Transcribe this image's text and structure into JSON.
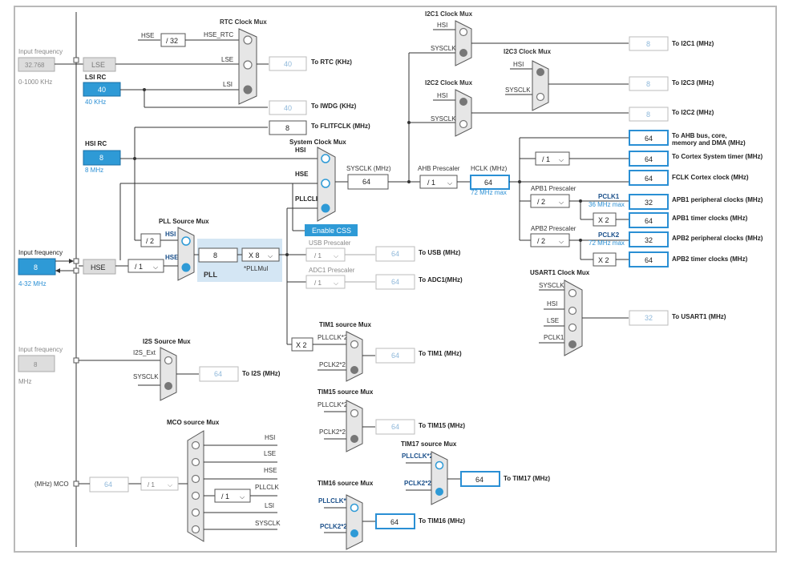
{
  "rtc_mux": {
    "title": "RTC Clock Mux",
    "in_hse": "HSE",
    "div32": "/ 32",
    "in_hse_rtc": "HSE_RTC",
    "in_lse": "LSE",
    "in_lsi": "LSI",
    "out_value": "40",
    "out_label": "To RTC (KHz)"
  },
  "input_freq_top": {
    "label": "Input frequency",
    "value": "32.768",
    "range": "0-1000 KHz"
  },
  "lse": {
    "label": "LSE"
  },
  "lsi_rc": {
    "title": "LSI RC",
    "value": "40",
    "sub": "40 KHz"
  },
  "iwdg": {
    "value": "40",
    "label": "To IWDG (KHz)"
  },
  "flitf": {
    "value": "8",
    "label": "To FLITFCLK (MHz)"
  },
  "hsi_rc": {
    "title": "HSI RC",
    "value": "8",
    "sub": "8 MHz"
  },
  "sys_mux": {
    "title": "System Clock Mux",
    "hsi": "HSI",
    "hse": "HSE",
    "pllclk": "PLLCLK"
  },
  "sysclk": {
    "label": "SYSCLK (MHz)",
    "value": "64"
  },
  "ahb": {
    "label": "AHB Prescaler",
    "value": "/ 1"
  },
  "hclk": {
    "label": "HCLK (MHz)",
    "value": "64",
    "sub": "72 MHz max"
  },
  "enable_css": "Enable CSS",
  "i2c1": {
    "title": "I2C1 Clock Mux",
    "hsi": "HSI",
    "sysclk": "SYSCLK",
    "value": "8",
    "label": "To I2C1 (MHz)"
  },
  "i2c3": {
    "title": "I2C3 Clock Mux",
    "hsi": "HSI",
    "sysclk": "SYSCLK",
    "value": "8",
    "label": "To I2C3 (MHz)"
  },
  "i2c2": {
    "title": "I2C2 Clock Mux",
    "hsi": "HSI",
    "sysclk": "SYSCLK",
    "value": "8",
    "label": "To I2C2 (MHz)"
  },
  "ahb_out": {
    "value": "64",
    "label1": "To AHB bus, core,",
    "label2": "memory and DMA (MHz)"
  },
  "cortex": {
    "div": "/ 1",
    "value": "64",
    "label": "To Cortex System timer (MHz)"
  },
  "fclk": {
    "value": "64",
    "label": "FCLK Cortex clock (MHz)"
  },
  "apb1": {
    "title": "APB1 Prescaler",
    "div": "/ 2",
    "pclk": "PCLK1",
    "max": "36 MHz max",
    "value": "32",
    "label": "APB1 peripheral clocks (MHz)",
    "mult": "X 2",
    "timer_value": "64",
    "timer_label": "APB1 timer clocks (MHz)"
  },
  "apb2": {
    "title": "APB2 Prescaler",
    "div": "/ 2",
    "pclk": "PCLK2",
    "max": "72 MHz max",
    "value": "32",
    "label": "APB2 peripheral clocks (MHz)",
    "mult": "X 2",
    "timer_value": "64",
    "timer_label": "APB2 timer clocks (MHz)"
  },
  "pll_src": {
    "title": "PLL Source Mux",
    "div2": "/ 2",
    "hsi": "HSI",
    "hse": "HSE"
  },
  "input_freq_hse": {
    "label": "Input frequency",
    "value": "8",
    "range": "4-32 MHz"
  },
  "hse": {
    "label": "HSE",
    "div": "/ 1"
  },
  "pll": {
    "value": "8",
    "mul": "X 8",
    "label": "PLL",
    "mul_label": "*PLLMul"
  },
  "usb": {
    "title": "USB Prescaler",
    "div": "/ 1",
    "value": "64",
    "label": "To USB (MHz)"
  },
  "adc": {
    "title": "ADC1 Prescaler",
    "div": "/ 1",
    "value": "64",
    "label": "To ADC1(MHz)"
  },
  "usart1": {
    "title": "USART1 Clock Mux",
    "in1": "SYSCLK",
    "in2": "HSI",
    "in3": "LSE",
    "in4": "PCLK1",
    "value": "32",
    "label": "To USART1 (MHz)"
  },
  "tim1": {
    "title": "TIM1 source Mux",
    "mult": "X 2",
    "in1": "PLLCLK*2",
    "in2": "PCLK2*2",
    "value": "64",
    "label": "To TIM1 (MHz)"
  },
  "i2s": {
    "title": "I2S Source Mux",
    "in1": "I2S_Ext",
    "in2": "SYSCLK",
    "value": "64",
    "label": "To I2S (MHz)"
  },
  "input_freq_i2s": {
    "label": "Input frequency",
    "value": "8",
    "unit": "MHz"
  },
  "tim15": {
    "title": "TIM15 source Mux",
    "in1": "PLLCLK*2",
    "in2": "PCLK2*2",
    "value": "64",
    "label": "To TIM15 (MHz)"
  },
  "tim17": {
    "title": "TIM17 source Mux",
    "in1": "PLLCLK*2",
    "in2": "PCLK2*2",
    "value": "64",
    "label": "To TIM17 (MHz)"
  },
  "tim16": {
    "title": "TIM16 source Mux",
    "in1": "PLLCLK*2",
    "in2": "PCLK2*2",
    "value": "64",
    "label": "To TIM16 (MHz)"
  },
  "mco": {
    "title": "MCO source Mux",
    "in1": "HSI",
    "in2": "LSE",
    "in3": "HSE",
    "in4": "PLLCLK",
    "in5": "LSI",
    "in6": "SYSCLK",
    "pll_div": "/ 1",
    "div": "/ 1",
    "value": "64",
    "label": "(MHz) MCO"
  },
  "colors": {
    "accent": "#2e9ad6",
    "line": "#333333",
    "disabled": "#8fb8da"
  }
}
